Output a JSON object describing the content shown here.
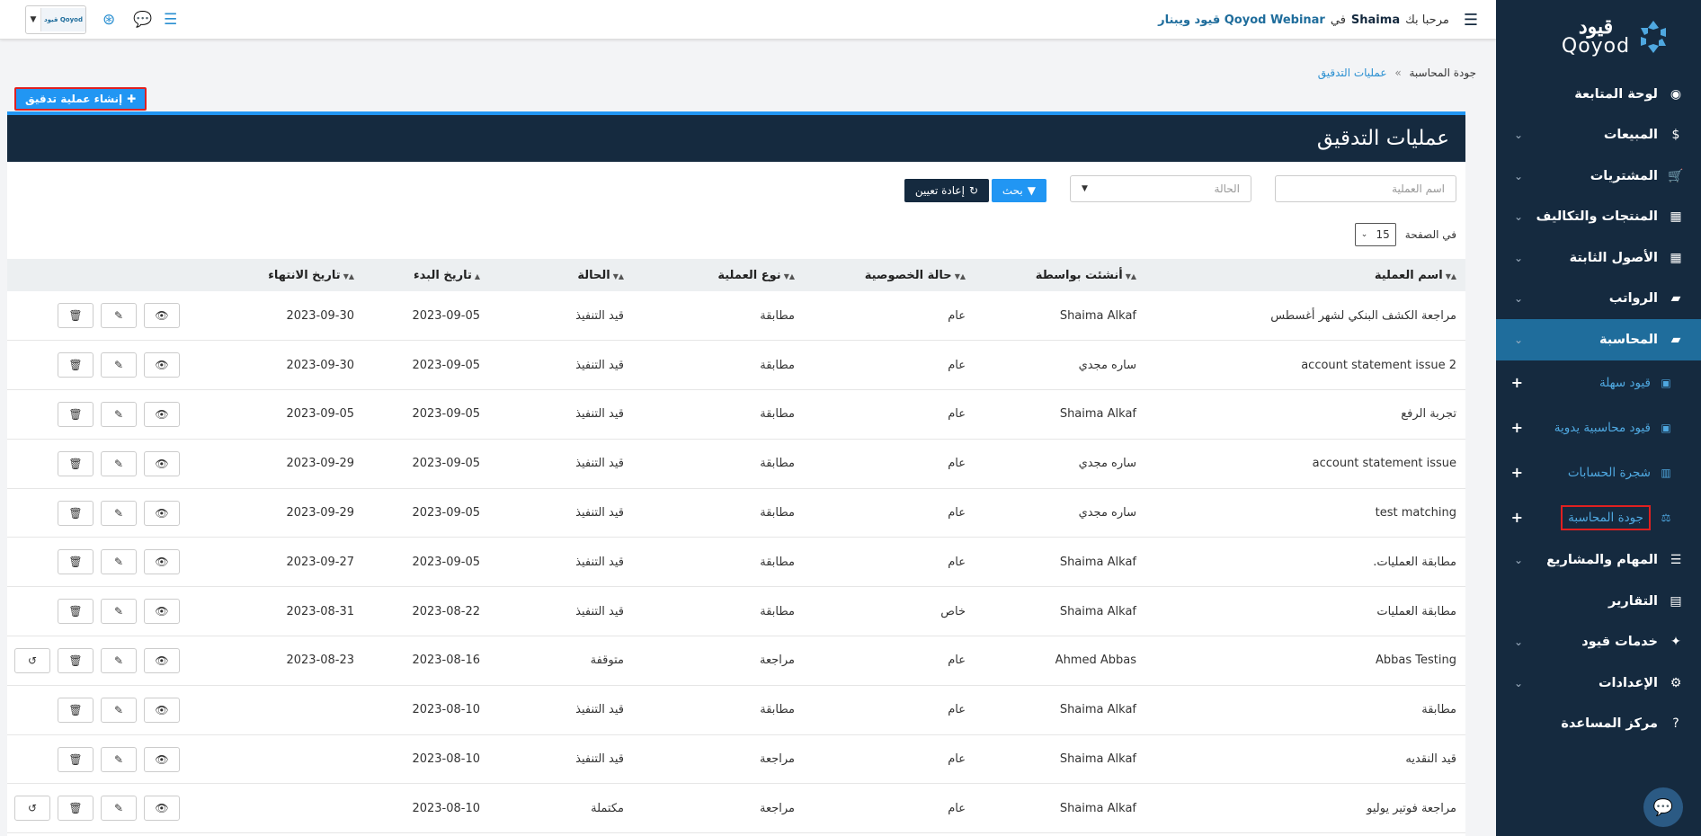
{
  "sidebar": {
    "logo_ar": "قيود",
    "logo_en": "Qoyod",
    "items": [
      {
        "label": "لوحة المتابعة",
        "icon": "dashboard-icon",
        "glyph": "◉",
        "chevron": false
      },
      {
        "label": "المبيعات",
        "icon": "dollar-icon",
        "glyph": "$",
        "chevron": true
      },
      {
        "label": "المشتريات",
        "icon": "cart-icon",
        "glyph": "🛒",
        "chevron": true
      },
      {
        "label": "المنتجات والتكاليف",
        "icon": "grid-icon",
        "glyph": "▦",
        "chevron": true
      },
      {
        "label": "الأصول الثابتة",
        "icon": "grid-icon",
        "glyph": "▦",
        "chevron": true
      },
      {
        "label": "الرواتب",
        "icon": "folder-icon",
        "glyph": "▰",
        "chevron": true
      },
      {
        "label": "المحاسبة",
        "icon": "folder-open-icon",
        "glyph": "▰",
        "chevron": true
      }
    ],
    "sub_items": [
      {
        "label": "قيود سهلة",
        "icon": "book-icon"
      },
      {
        "label": "قيود محاسبية يدوية",
        "icon": "book-icon"
      },
      {
        "label": "شجرة الحسابات",
        "icon": "bar-chart-icon"
      },
      {
        "label": "جودة المحاسبة",
        "icon": "balance-scale-icon"
      }
    ],
    "items_after": [
      {
        "label": "المهام والمشاريع",
        "icon": "list-icon",
        "glyph": "☰",
        "chevron": true
      },
      {
        "label": "التقارير",
        "icon": "file-icon",
        "glyph": "▤",
        "chevron": false
      },
      {
        "label": "خدمات قيود",
        "icon": "services-icon",
        "glyph": "✦",
        "chevron": true
      },
      {
        "label": "الإعدادات",
        "icon": "gear-icon",
        "glyph": "⚙",
        "chevron": true
      },
      {
        "label": "مركز المساعدة",
        "icon": "help-icon",
        "glyph": "?",
        "chevron": false
      }
    ]
  },
  "topbar": {
    "greeting_prefix": "مرحبا بك",
    "user": "Shaima",
    "in_word": "في",
    "org": "Qoyod Webinar قيود ويبنار",
    "company_logo": "قيود Qoyod"
  },
  "breadcrumb": {
    "parent": "جودة المحاسبة",
    "current": "عمليات التدقيق"
  },
  "create_button": "إنشاء عملية تدقيق",
  "panel_title": "عمليات التدقيق",
  "filters": {
    "name_placeholder": "اسم العملية",
    "status_placeholder": "الحالة",
    "search_label": "بحث",
    "reset_label": "إعادة تعيين",
    "per_page_label": "في الصفحة",
    "per_page_value": "15"
  },
  "table": {
    "headers": [
      "اسم العملية",
      "أنشئت بواسطة",
      "حالة الخصوصية",
      "نوع العملية",
      "الحالة",
      "تاريخ البدء",
      "تاريخ الانتهاء"
    ],
    "rows": [
      {
        "name": "مراجعة الكشف البنكي لشهر أغسطس",
        "by": "Shaima Alkaf",
        "privacy": "عام",
        "type": "مطابقة",
        "status": "قيد التنفيذ",
        "start": "2023-09-05",
        "end": "2023-09-30",
        "restore": false
      },
      {
        "name": "account statement issue 2",
        "by": "ساره مجدي",
        "privacy": "عام",
        "type": "مطابقة",
        "status": "قيد التنفيذ",
        "start": "2023-09-05",
        "end": "2023-09-30",
        "restore": false
      },
      {
        "name": "تجربة الرفع",
        "by": "Shaima Alkaf",
        "privacy": "عام",
        "type": "مطابقة",
        "status": "قيد التنفيذ",
        "start": "2023-09-05",
        "end": "2023-09-05",
        "restore": false
      },
      {
        "name": "account statement issue",
        "by": "ساره مجدي",
        "privacy": "عام",
        "type": "مطابقة",
        "status": "قيد التنفيذ",
        "start": "2023-09-05",
        "end": "2023-09-29",
        "restore": false
      },
      {
        "name": "test matching",
        "by": "ساره مجدي",
        "privacy": "عام",
        "type": "مطابقة",
        "status": "قيد التنفيذ",
        "start": "2023-09-05",
        "end": "2023-09-29",
        "restore": false
      },
      {
        "name": "مطابقة العمليات.",
        "by": "Shaima Alkaf",
        "privacy": "عام",
        "type": "مطابقة",
        "status": "قيد التنفيذ",
        "start": "2023-09-05",
        "end": "2023-09-27",
        "restore": false
      },
      {
        "name": "مطابقة العمليات",
        "by": "Shaima Alkaf",
        "privacy": "خاص",
        "type": "مطابقة",
        "status": "قيد التنفيذ",
        "start": "2023-08-22",
        "end": "2023-08-31",
        "restore": false
      },
      {
        "name": "Abbas Testing",
        "by": "Ahmed Abbas",
        "privacy": "عام",
        "type": "مراجعة",
        "status": "متوقفة",
        "start": "2023-08-16",
        "end": "2023-08-23",
        "restore": true
      },
      {
        "name": "مطابقة",
        "by": "Shaima Alkaf",
        "privacy": "عام",
        "type": "مطابقة",
        "status": "قيد التنفيذ",
        "start": "2023-08-10",
        "end": "",
        "restore": false
      },
      {
        "name": "قيد النقديه",
        "by": "Shaima Alkaf",
        "privacy": "عام",
        "type": "مراجعة",
        "status": "قيد التنفيذ",
        "start": "2023-08-10",
        "end": "",
        "restore": false
      },
      {
        "name": "مراجعة فوتير يوليو",
        "by": "Shaima Alkaf",
        "privacy": "عام",
        "type": "مراجعة",
        "status": "مكتملة",
        "start": "2023-08-10",
        "end": "",
        "restore": true
      }
    ]
  }
}
